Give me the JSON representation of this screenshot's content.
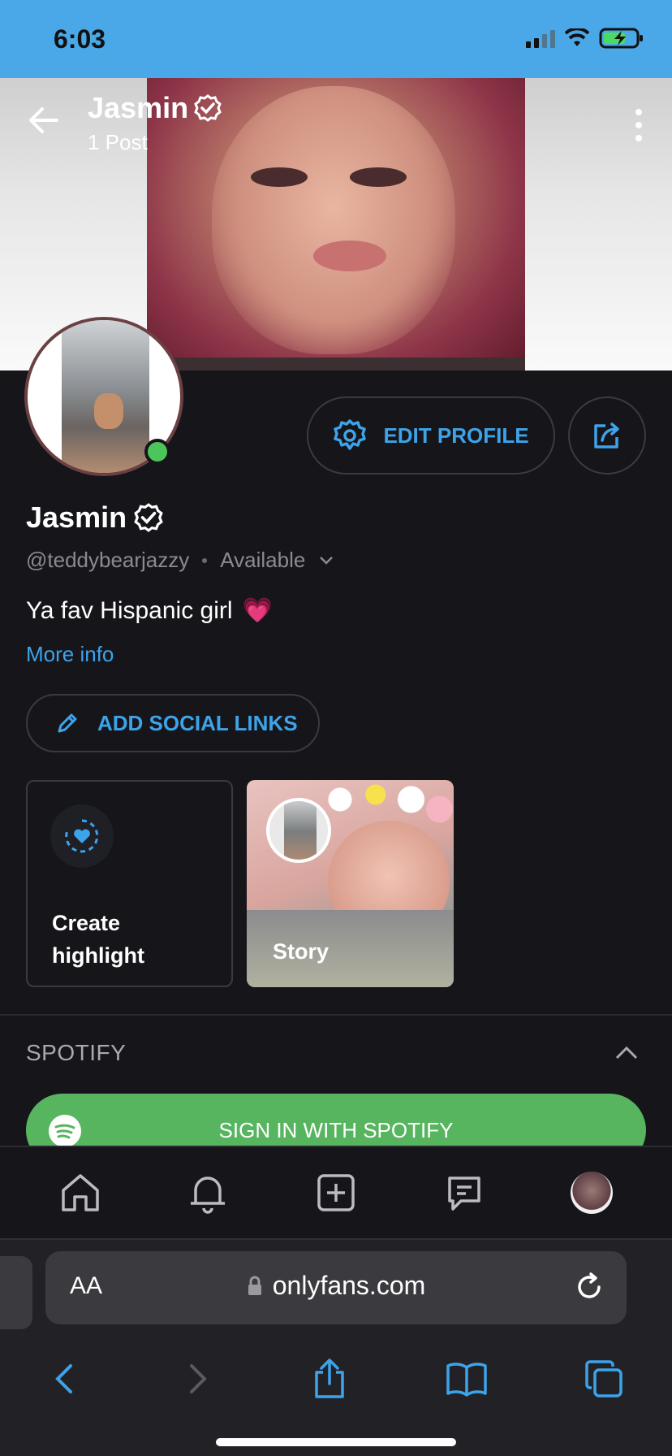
{
  "status_bar": {
    "time": "6:03"
  },
  "header": {
    "name": "Jasmin",
    "post_count": "1 Post"
  },
  "profile": {
    "name": "Jasmin",
    "handle": "@teddybearjazzy",
    "availability": "Available",
    "bio": "Ya fav Hispanic girl",
    "bio_emoji": "💗",
    "more_info": "More info"
  },
  "actions": {
    "edit_profile": "EDIT PROFILE",
    "add_social_links": "ADD SOCIAL LINKS"
  },
  "highlights": {
    "create_label": "Create highlight",
    "story_label": "Story"
  },
  "spotify": {
    "section_title": "SPOTIFY",
    "sign_in": "SIGN IN WITH SPOTIFY"
  },
  "browser": {
    "url": "onlyfans.com",
    "text_size_label": "AA"
  },
  "colors": {
    "accent": "#3da3ea",
    "online": "#4cc65a",
    "spotify": "#57b560",
    "status_bar": "#4aa8e8"
  }
}
